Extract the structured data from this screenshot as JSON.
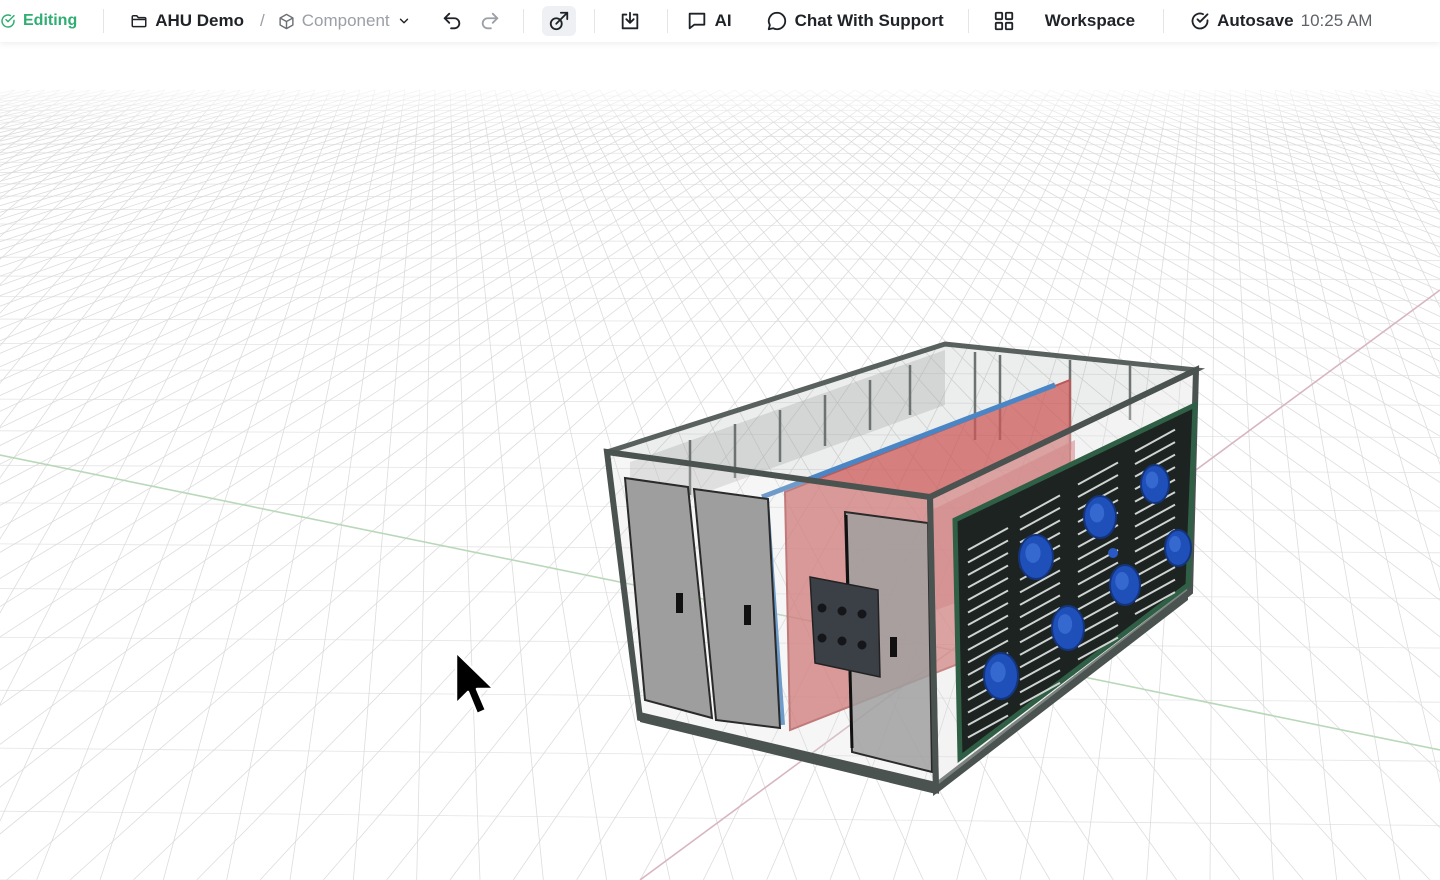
{
  "toolbar": {
    "status": {
      "label": "Editing",
      "icon": "check-circle-icon",
      "color": "#2fae72"
    },
    "breadcrumb": {
      "project": {
        "label": "AHU Demo",
        "icon": "folder-icon"
      },
      "separator": "/",
      "component": {
        "label": "Component",
        "icon": "cube-icon",
        "dropdown_icon": "chevron-down-icon"
      }
    },
    "actions": [
      {
        "name": "undo",
        "icon": "undo-icon"
      },
      {
        "name": "redo",
        "icon": "redo-icon"
      },
      {
        "name": "share",
        "icon": "share-icon",
        "active": true
      },
      {
        "name": "download",
        "icon": "download-icon"
      }
    ],
    "ai": {
      "label": "AI",
      "icon": "message-square-icon"
    },
    "support": {
      "label": "Chat With Support",
      "icon": "message-circle-icon"
    },
    "workspace": {
      "label": "Workspace",
      "icon": "grid-icon"
    },
    "autosave": {
      "label": "Autosave",
      "time": "10:25 AM",
      "icon": "check-circle-icon"
    }
  },
  "viewport": {
    "scene": "3D air handling unit model on grid floor",
    "colors": {
      "background": "#ffffff",
      "grid": "#d9d9d9",
      "axis_x": "#d8b6bf",
      "axis_z": "#b9d8b9",
      "frame": "#4a5350",
      "door": "#9c9c9c",
      "coil": "#d06565",
      "fan_panel": "#1d2321",
      "fan": "#1f4fb8",
      "cursor": "#000000"
    }
  }
}
